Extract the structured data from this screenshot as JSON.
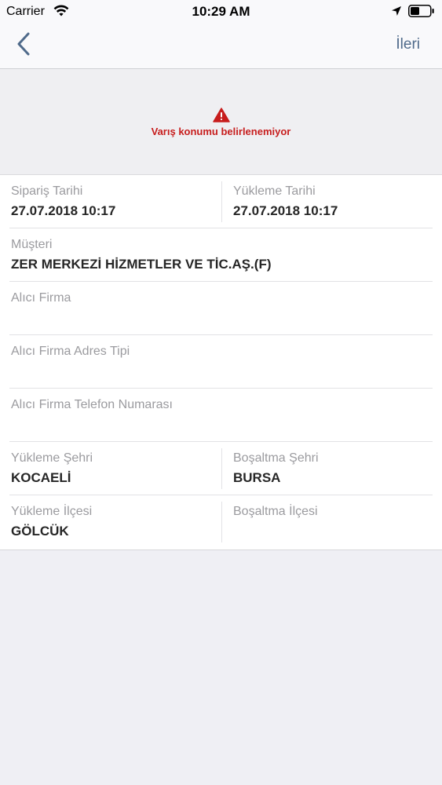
{
  "status_bar": {
    "carrier": "Carrier",
    "time": "10:29 AM"
  },
  "nav": {
    "next_label": "İleri"
  },
  "map": {
    "warning_text": "Varış konumu belirlenemiyor"
  },
  "fields": {
    "order_date": {
      "label": "Sipariş Tarihi",
      "value": "27.07.2018 10:17"
    },
    "loading_date": {
      "label": "Yükleme Tarihi",
      "value": "27.07.2018 10:17"
    },
    "customer": {
      "label": "Müşteri",
      "value": "ZER MERKEZİ HİZMETLER VE TİC.AŞ.(F)"
    },
    "receiver_company": {
      "label": "Alıcı Firma",
      "value": ""
    },
    "receiver_address_type": {
      "label": "Alıcı Firma Adres Tipi",
      "value": ""
    },
    "receiver_phone": {
      "label": "Alıcı Firma Telefon Numarası",
      "value": ""
    },
    "loading_city": {
      "label": "Yükleme Şehri",
      "value": "KOCAELİ"
    },
    "unloading_city": {
      "label": "Boşaltma Şehri",
      "value": "BURSA"
    },
    "loading_district": {
      "label": "Yükleme İlçesi",
      "value": "GÖLCÜK"
    },
    "unloading_district": {
      "label": "Boşaltma İlçesi",
      "value": ""
    }
  },
  "colors": {
    "accent": "#4f6a8a",
    "warning": "#c71d1d",
    "label": "#9b9b9f",
    "value": "#262626"
  }
}
